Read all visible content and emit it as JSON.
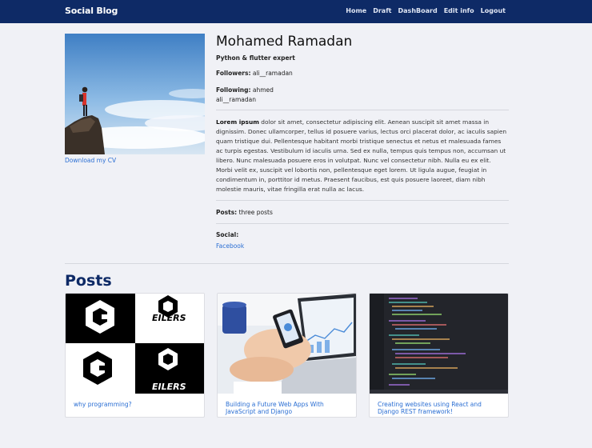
{
  "navbar": {
    "brand": "Social Blog",
    "links": [
      "Home",
      "Draft",
      "DashBoard",
      "Edit info",
      "Logout"
    ]
  },
  "profile": {
    "name": "Mohamed Ramadan",
    "tagline": "Python & flutter expert",
    "followers_label": "Followers:",
    "followers_value": "ali__ramadan",
    "following_label": "Following:",
    "following_values": [
      "ahmed",
      "ali__ramadan"
    ],
    "bio_lead": "Lorem ipsum",
    "bio_text": "dolor sit amet, consectetur adipiscing elit. Aenean suscipit sit amet massa in dignissim. Donec ullamcorper, tellus id posuere varius, lectus orci placerat dolor, ac iaculis sapien quam tristique dui. Pellentesque habitant morbi tristique senectus et netus et malesuada fames ac turpis egestas. Vestibulum id iaculis urna. Sed ex nulla, tempus quis tempus non, accumsan ut libero. Nunc malesuada posuere eros in volutpat. Nunc vel consectetur nibh. Nulla eu ex elit. Morbi velit ex, suscipit vel lobortis non, pellentesque eget lorem. Ut ligula augue, feugiat in condimentum in, porttitor id metus. Praesent faucibus, est quis posuere laoreet, diam nibh molestie mauris, vitae fringilla erat nulla ac lacus.",
    "posts_label": "Posts:",
    "posts_value": "three posts",
    "social_label": "Social:",
    "social_link": "Facebook",
    "cv_link": "Download my CV"
  },
  "posts_section": {
    "heading": "Posts",
    "cards": [
      {
        "title": "why programming?",
        "logo_text": "EILERS"
      },
      {
        "title": "Building a Future Web Apps With JavaScript and Django"
      },
      {
        "title": "Creating websites using React and Django REST framework!"
      }
    ]
  },
  "colors": {
    "navbar": "#0e2a66",
    "link": "#2a6ed3",
    "background": "#f0f1f6"
  }
}
